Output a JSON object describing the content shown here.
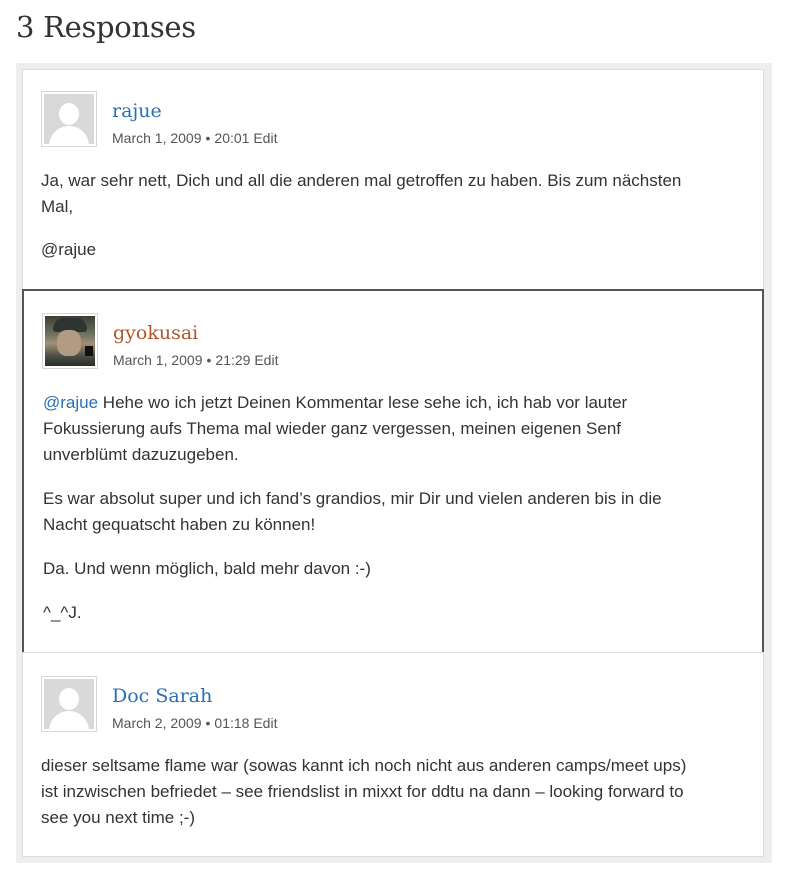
{
  "heading": "3 Responses",
  "comments": [
    {
      "author": "rajue",
      "date": "March 1, 2009",
      "separator": "•",
      "time": "20:01",
      "edit": "Edit",
      "p1": "Ja, war sehr nett, Dich und all die anderen mal getroffen zu haben. Bis zum nächsten",
      "p1b": "Mal,",
      "p2": "@rajue"
    },
    {
      "author": "gyokusai",
      "date": "March 1, 2009",
      "separator": "•",
      "time": "21:29",
      "edit": "Edit",
      "mention": "@rajue",
      "p1a": " Hehe wo ich jetzt Deinen Kommentar lese sehe ich, ich hab vor lauter",
      "p1b": "Fokussierung aufs Thema mal wieder ganz vergessen, meinen eigenen Senf",
      "p1c": "unverblümt dazuzugeben.",
      "p2a": "Es war absolut super und ich fand’s grandios, mir Dir und vielen anderen bis in die",
      "p2b": "Nacht gequatscht haben zu können!",
      "p3": "Da. Und wenn möglich, bald mehr davon :-)",
      "p4": "^_^J."
    },
    {
      "author": "Doc Sarah",
      "date": "March 2, 2009",
      "separator": "•",
      "time": "01:18",
      "edit": "Edit",
      "p1a": "dieser seltsame flame war (sowas kannt ich noch nicht aus anderen camps/meet ups)",
      "p1b": "ist inzwischen befriedet – see friendslist in mixxt for ddtu na dann – looking forward to",
      "p1c": "see you next time ;-)"
    }
  ],
  "colors": {
    "link": "#2b6fb4",
    "author_highlight": "#b0552b"
  }
}
